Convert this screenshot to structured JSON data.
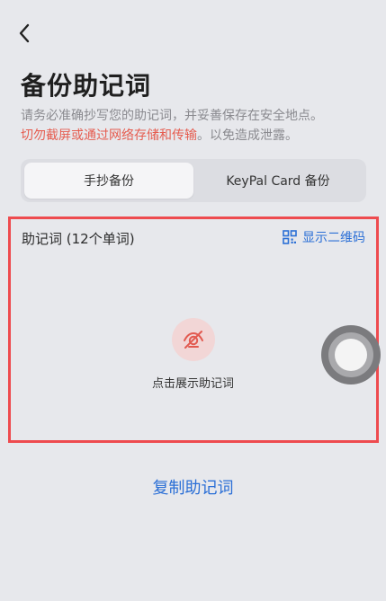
{
  "header": {
    "back_icon": "chevron-left-icon",
    "title": "备份助记词"
  },
  "description": {
    "line1": "请务必准确抄写您的助记词，并妥善保存在安全地点。",
    "warning": "切勿截屏或通过网络存储和传输",
    "tail": "。以免造成泄露。"
  },
  "tabs": [
    {
      "label": "手抄备份",
      "active": true
    },
    {
      "label": "KeyPal Card 备份",
      "active": false
    }
  ],
  "mnemonic": {
    "label": "助记词 (12个单词)",
    "qr_label": "显示二维码",
    "qr_icon": "qr-code-icon",
    "reveal_icon": "eye-off-icon",
    "reveal_text": "点击展示助记词"
  },
  "copy_label": "复制助记词",
  "colors": {
    "accent": "#2b6fd6",
    "warning": "#e65c4f",
    "highlight": "#ee4b4f",
    "background": "#e7e8ec"
  }
}
